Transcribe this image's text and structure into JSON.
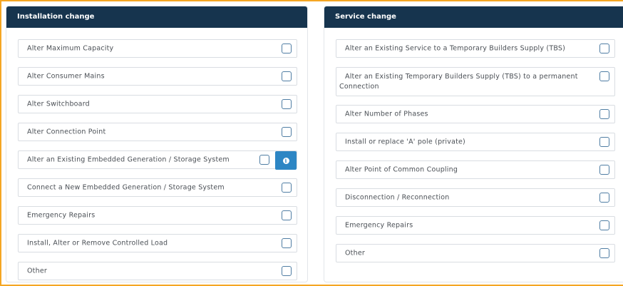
{
  "installation": {
    "title": "Installation change",
    "items": [
      {
        "label": "Alter Maximum Capacity"
      },
      {
        "label": "Alter Consumer Mains"
      },
      {
        "label": "Alter Switchboard"
      },
      {
        "label": "Alter Connection Point"
      },
      {
        "label": "Alter an Existing Embedded Generation / Storage System",
        "info_icon": "info-icon"
      },
      {
        "label": "Connect a New Embedded Generation / Storage System"
      },
      {
        "label": "Emergency Repairs"
      },
      {
        "label": "Install, Alter or Remove Controlled Load"
      },
      {
        "label": "Other"
      }
    ]
  },
  "service": {
    "title": "Service change",
    "items": [
      {
        "label": "Alter an Existing Service to a Temporary Builders Supply (TBS)"
      },
      {
        "label": "Alter an Existing Temporary Builders Supply (TBS) to a permanent Connection"
      },
      {
        "label": "Alter Number of Phases"
      },
      {
        "label": "Install or replace 'A' pole (private)"
      },
      {
        "label": "Alter Point of Common Coupling"
      },
      {
        "label": "Disconnection / Reconnection"
      },
      {
        "label": "Emergency Repairs"
      },
      {
        "label": "Other"
      }
    ]
  },
  "colors": {
    "header": "#16344e",
    "accent": "#2d86c4",
    "frame": "#f5a623"
  }
}
